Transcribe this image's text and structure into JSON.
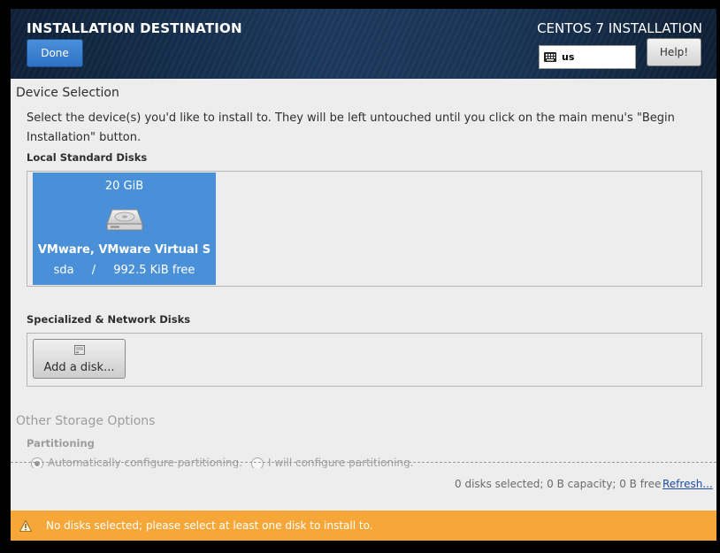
{
  "header": {
    "title": "INSTALLATION DESTINATION",
    "product": "CENTOS 7 INSTALLATION",
    "done_label": "Done",
    "help_label": "Help!",
    "keyboard_layout": "us"
  },
  "device_selection": {
    "title": "Device Selection",
    "description": "Select the device(s) you'd like to install to.  They will be left untouched until you click on the main menu's \"Begin Installation\" button.",
    "local_label": "Local Standard Disks",
    "disks": [
      {
        "size": "20 GiB",
        "name": "VMware, VMware Virtual S",
        "device": "sda",
        "separator": "/",
        "free": "992.5 KiB free"
      }
    ],
    "network_label": "Specialized & Network Disks",
    "add_disk_label": "Add a disk..."
  },
  "other_storage": {
    "title": "Other Storage Options",
    "partitioning_label": "Partitioning",
    "options": [
      {
        "label": "Automatically configure partitioning.",
        "checked": true
      },
      {
        "label": "I will configure partitioning.",
        "checked": false
      }
    ]
  },
  "summary": {
    "text": "0 disks selected; 0 B capacity; 0 B free",
    "refresh_label": "Refresh..."
  },
  "warning": {
    "text": "No disks selected; please select at least one disk to install to."
  },
  "colors": {
    "accent": "#4a90d9",
    "warning_bar": "#f7a738",
    "link": "#1d4fa3"
  }
}
